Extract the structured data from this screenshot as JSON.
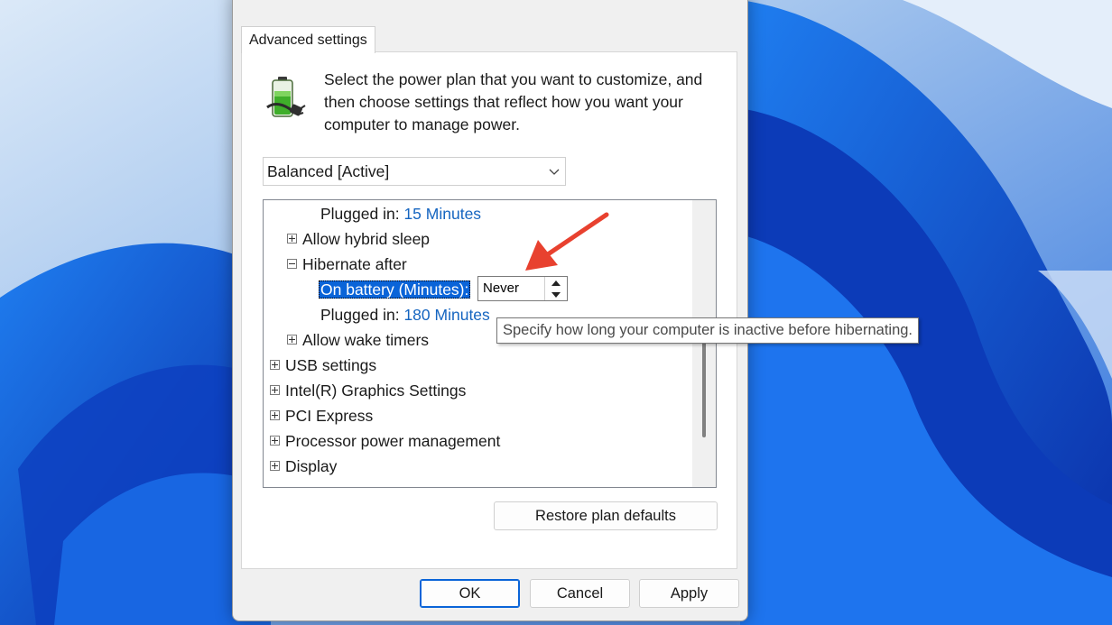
{
  "dialog": {
    "tab_label": "Advanced settings",
    "intro_text": "Select the power plan that you want to customize, and then choose settings that reflect how you want your computer to manage power.",
    "plan_selected": "Balanced [Active]",
    "icon": "power-options-battery-plug-icon"
  },
  "tree": {
    "plugged_in_1_label": "Plugged in:",
    "plugged_in_1_value": "15 Minutes",
    "allow_hybrid_sleep": "Allow hybrid sleep",
    "hibernate_after": "Hibernate after",
    "on_battery_label": "On battery (Minutes):",
    "on_battery_value": "Never",
    "plugged_in_2_label": "Plugged in:",
    "plugged_in_2_value": "180 Minutes",
    "allow_wake_timers": "Allow wake timers",
    "usb_settings": "USB settings",
    "intel_graphics": "Intel(R) Graphics Settings",
    "pci_express": "PCI Express",
    "processor_power": "Processor power management",
    "display": "Display"
  },
  "tooltip": "Specify how long your computer is inactive before hibernating.",
  "buttons": {
    "restore": "Restore plan defaults",
    "ok": "OK",
    "cancel": "Cancel",
    "apply": "Apply"
  },
  "colors": {
    "accent": "#0a64d8",
    "value_link": "#1565c0",
    "annotation_arrow": "#e8412f",
    "wallpaper": "#1c5fd8"
  }
}
